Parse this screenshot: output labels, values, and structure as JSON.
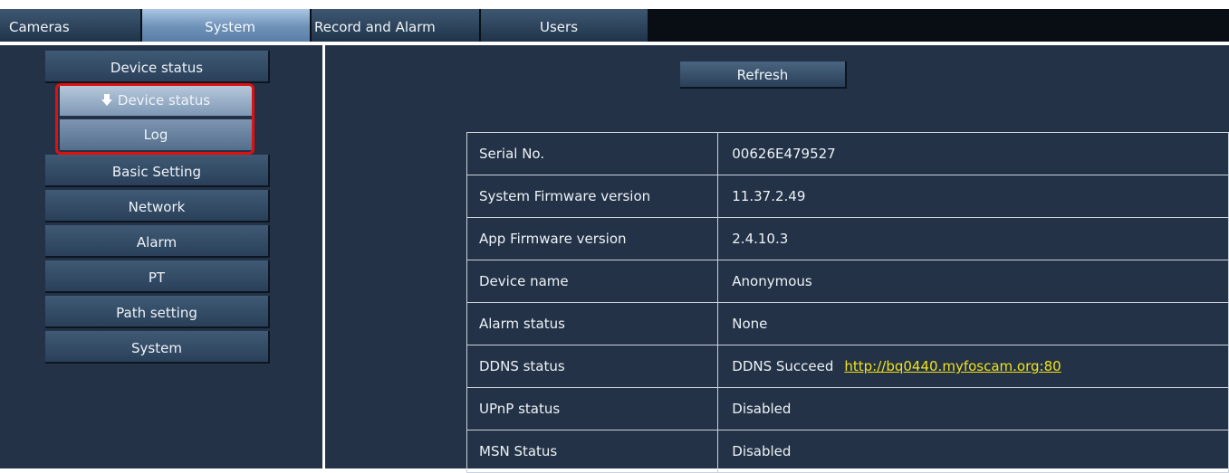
{
  "tabs": {
    "cameras": "Cameras",
    "system": "System",
    "record_alarm": "Record and Alarm",
    "users": "Users"
  },
  "sidebar": {
    "items": [
      {
        "label": "Device status"
      },
      {
        "label": "Basic Setting"
      },
      {
        "label": "Network"
      },
      {
        "label": "Alarm"
      },
      {
        "label": "PT"
      },
      {
        "label": "Path setting"
      },
      {
        "label": "System"
      }
    ],
    "sub_items": [
      {
        "label": "Device status",
        "icon": "down-arrow-icon"
      },
      {
        "label": "Log"
      }
    ]
  },
  "main": {
    "refresh_label": "Refresh",
    "rows": [
      {
        "label": "Serial No.",
        "value": "00626E479527"
      },
      {
        "label": "System Firmware version",
        "value": "11.37.2.49"
      },
      {
        "label": "App Firmware version",
        "value": "2.4.10.3"
      },
      {
        "label": "Device name",
        "value": "Anonymous"
      },
      {
        "label": "Alarm status",
        "value": "None"
      },
      {
        "label": "DDNS status",
        "value": "DDNS Succeed",
        "link": "http://bq0440.myfoscam.org:80"
      },
      {
        "label": "UPnP status",
        "value": "Disabled"
      },
      {
        "label": "MSN Status",
        "value": "Disabled"
      }
    ]
  },
  "colors": {
    "panel_bg": "#233246",
    "link": "#f2e21a",
    "highlight": "#e01010"
  }
}
